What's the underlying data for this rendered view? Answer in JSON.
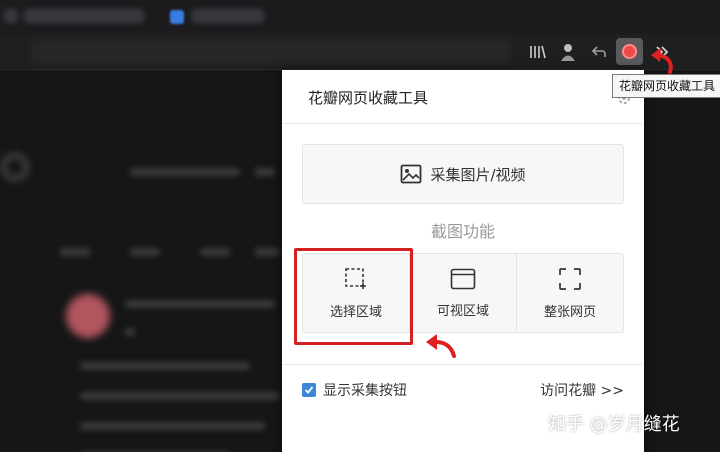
{
  "popup": {
    "title": "花瓣网页收藏工具",
    "collect_button_label": "采集图片/视频",
    "screenshot_section_label": "截图功能",
    "modes": [
      {
        "label": "选择区域",
        "icon": "select-region-icon"
      },
      {
        "label": "可视区域",
        "icon": "browser-window-icon"
      },
      {
        "label": "整张网页",
        "icon": "fullscreen-icon"
      }
    ],
    "show_button_label": "显示采集按钮",
    "show_button_checked": true,
    "visit_link_label": "访问花瓣 >>"
  },
  "tooltip": {
    "text": "花瓣网页收藏工具"
  },
  "watermark": {
    "text": "知乎 @岁月缝花"
  },
  "colors": {
    "accent_red": "#d42020",
    "checkbox_blue": "#3d87d8",
    "extension_red": "#f04848"
  }
}
